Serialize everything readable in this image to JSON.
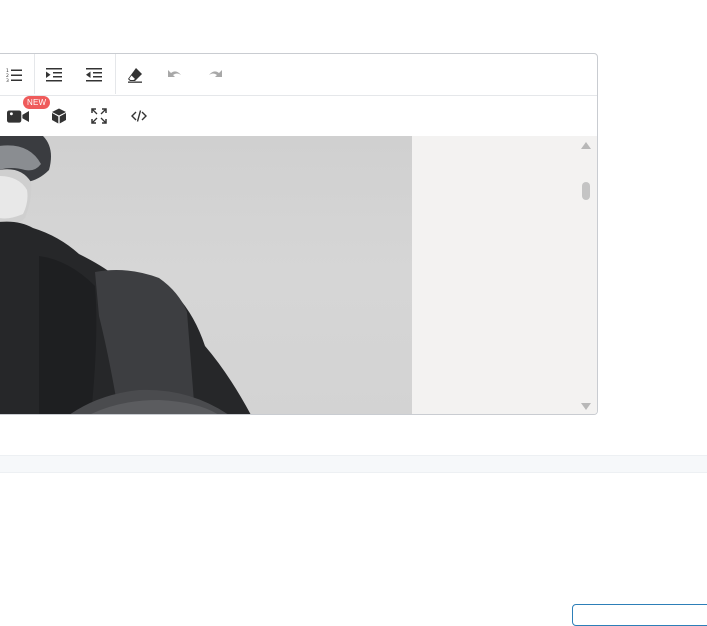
{
  "toolbar": {
    "row1": [
      "numbered-list",
      "indent",
      "outdent",
      "clear-formatting",
      "undo",
      "redo"
    ],
    "row2": [
      "insert-video",
      "insert-3d-object",
      "fullscreen",
      "source-code"
    ],
    "video_badge": "NEW"
  },
  "editor": {
    "content": "image-of-person-in-dark-jacket",
    "scroll": {
      "position_fraction": 0.12
    }
  },
  "colors": {
    "badge": "#ef5b5b",
    "icon": "#333333",
    "icon_disabled": "#a8a8a8",
    "border": "#c9ccd1",
    "content_bg": "#f3f2f1",
    "accent_button_border": "#2d7fb8"
  }
}
